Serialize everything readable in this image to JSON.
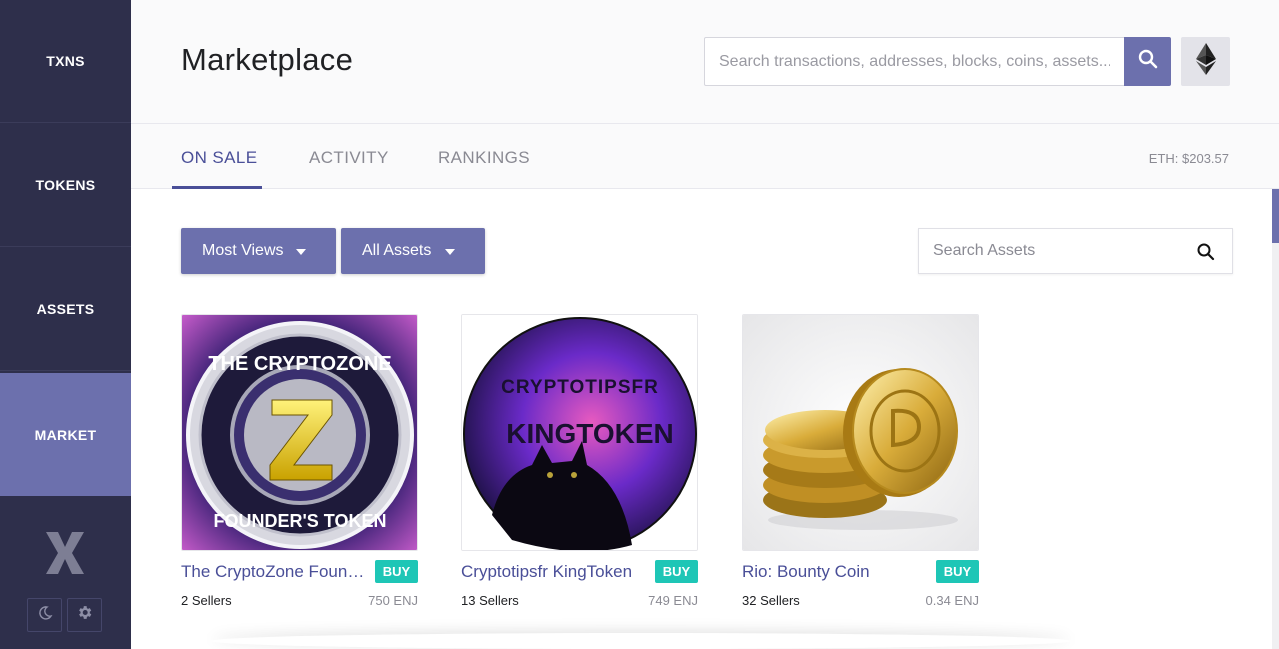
{
  "sidebar": {
    "items": [
      {
        "label": "TXNS"
      },
      {
        "label": "TOKENS"
      },
      {
        "label": "ASSETS"
      },
      {
        "label": "MARKET"
      }
    ],
    "active": "MARKET",
    "logo_icon": "x-logo-icon",
    "buttons": [
      {
        "icon": "moon-icon"
      },
      {
        "icon": "gear-icon"
      }
    ]
  },
  "header": {
    "title": "Marketplace",
    "search_placeholder": "Search transactions, addresses, blocks, coins, assets...",
    "search_icon": "search-icon",
    "network_icon": "ethereum-icon"
  },
  "tabs": {
    "items": [
      {
        "label": "ON SALE"
      },
      {
        "label": "ACTIVITY"
      },
      {
        "label": "RANKINGS"
      }
    ],
    "active": "ON SALE",
    "eth_price": "ETH: $203.57"
  },
  "filters": {
    "sort_label": "Most Views",
    "type_label": "All Assets",
    "asset_search_placeholder": "Search Assets"
  },
  "cards": [
    {
      "name": "The CryptoZone Founder's Token",
      "buy": "BUY",
      "sellers": "2 Sellers",
      "price": "750 ENJ"
    },
    {
      "name": "Cryptotipsfr KingToken",
      "buy": "BUY",
      "sellers": "13 Sellers",
      "price": "749 ENJ"
    },
    {
      "name": "Rio: Bounty Coin",
      "buy": "BUY",
      "sellers": "32 Sellers",
      "price": "0.34 ENJ"
    }
  ],
  "colors": {
    "sidebar_bg": "#2e2f4b",
    "accent": "#6c70ad",
    "tab_active": "#4a4f98",
    "buy_badge": "#1ec6b6"
  }
}
